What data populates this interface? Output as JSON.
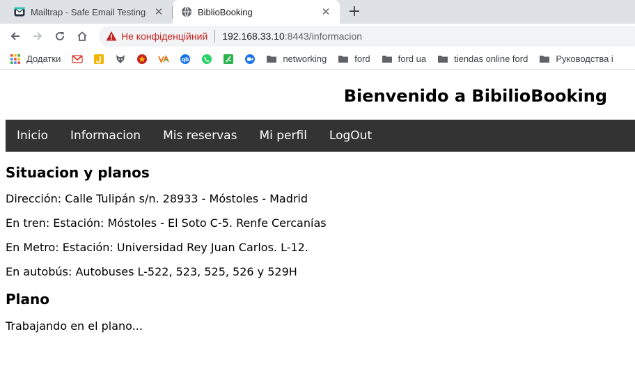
{
  "browser": {
    "tabs": [
      {
        "title": "Mailtrap - Safe Email Testing",
        "icon": "mailtrap-icon",
        "active": false
      },
      {
        "title": "BiblioBooking",
        "icon": "globe-icon",
        "active": true
      }
    ],
    "new_tab_symbol": "+",
    "close_symbol": "✕",
    "security_label": "Не конфіденційний",
    "url_host": "192.168.33.10",
    "url_rest": ":8443/informacion"
  },
  "bookmarks": [
    {
      "label": "Додатки",
      "icon": "apps-grid-icon"
    },
    {
      "label": "",
      "icon": "gmail-icon",
      "color": "#d93025"
    },
    {
      "label": "",
      "icon": "j-icon",
      "color": "#f5b400"
    },
    {
      "label": "",
      "icon": "fox-icon",
      "color": "#5f6368"
    },
    {
      "label": "",
      "icon": "star-badge-icon",
      "color": "#c5221f"
    },
    {
      "label": "",
      "icon": "va-icon",
      "color": "#e8710a"
    },
    {
      "label": "",
      "icon": "qb-icon",
      "color": "#1a73e8"
    },
    {
      "label": "",
      "icon": "whatsapp-icon",
      "color": "#25d366"
    },
    {
      "label": "",
      "icon": "feedly-icon",
      "color": "#2bb24c"
    },
    {
      "label": "",
      "icon": "meet-icon",
      "color": "#1a73e8"
    },
    {
      "label": "networking",
      "icon": "folder-icon"
    },
    {
      "label": "ford",
      "icon": "folder-icon"
    },
    {
      "label": "ford ua",
      "icon": "folder-icon"
    },
    {
      "label": "tiendas online ford",
      "icon": "folder-icon"
    },
    {
      "label": "Руководства i",
      "icon": "folder-icon"
    }
  ],
  "page": {
    "site_title": "Bienvenido a BibilioBooking",
    "nav": [
      "Inicio",
      "Informacion",
      "Mis reservas",
      "Mi perfil",
      "LogOut"
    ],
    "section1_title": "Situacion y planos",
    "lines": [
      "Dirección: Calle Tulipán s/n. 28933 - Móstoles - Madrid",
      "En tren: Estación: Móstoles - El Soto C-5. Renfe Cercanías",
      "En Metro: Estación: Universidad Rey Juan Carlos. L-12.",
      "En autobús: Autobuses L-522, 523, 525, 526 y 529H"
    ],
    "section2_title": "Plano",
    "plano_text": "Trabajando en el plano..."
  },
  "colors": {
    "tabstrip_bg": "#dee1e6",
    "navbar_bg": "#333333",
    "insecure_red": "#c5221f"
  }
}
